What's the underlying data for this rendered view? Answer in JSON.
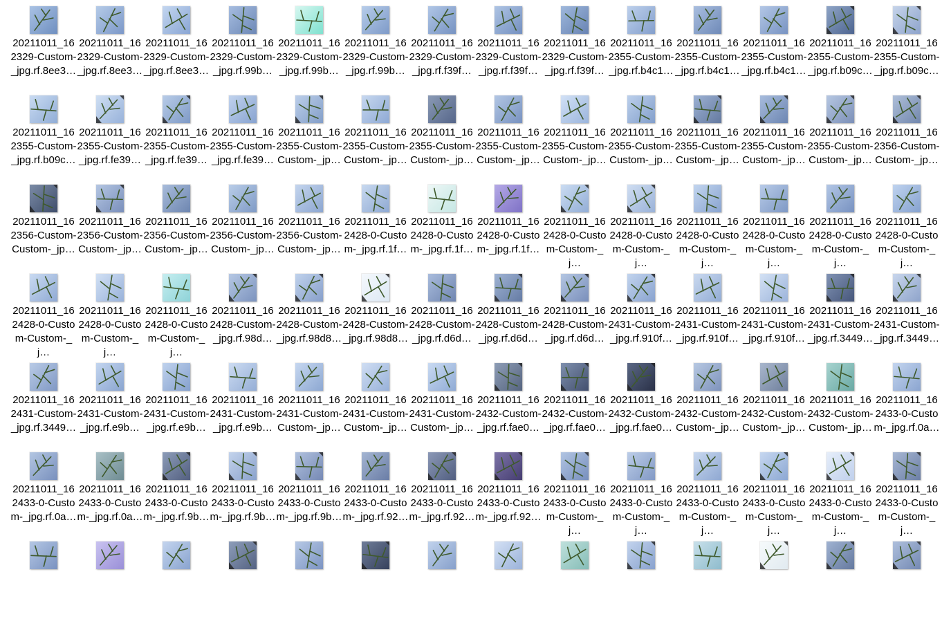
{
  "explorer": {
    "view": "large-icons",
    "files": [
      {
        "name": "20211011_162329-Custom-_jpg.rf.8ee3…",
        "bg": [
          "#a9c2e4",
          "#6f8fc0"
        ],
        "dark": false
      },
      {
        "name": "20211011_162329-Custom-_jpg.rf.8ee3…",
        "bg": [
          "#b5cbe8",
          "#7c98c8"
        ],
        "dark": false
      },
      {
        "name": "20211011_162329-Custom-_jpg.rf.8ee3…",
        "bg": [
          "#c3d6f0",
          "#8aa6d4"
        ],
        "dark": false
      },
      {
        "name": "20211011_162329-Custom-_jpg.rf.99b…",
        "bg": [
          "#a6bde0",
          "#6d88b6"
        ],
        "dark": false
      },
      {
        "name": "20211011_162329-Custom-_jpg.rf.99b…",
        "bg": [
          "#d6f7f0",
          "#7fe1cf"
        ],
        "dark": false
      },
      {
        "name": "20211011_162329-Custom-_jpg.rf.99b…",
        "bg": [
          "#b7cdea",
          "#7e9ac8"
        ],
        "dark": false
      },
      {
        "name": "20211011_162329-Custom-_jpg.rf.f39f…",
        "bg": [
          "#b0c6e6",
          "#7793c2"
        ],
        "dark": false
      },
      {
        "name": "20211011_162329-Custom-_jpg.rf.f39f…",
        "bg": [
          "#aec4e4",
          "#7490c0"
        ],
        "dark": false
      },
      {
        "name": "20211011_162329-Custom-_jpg.rf.f39f…",
        "bg": [
          "#9fb8dc",
          "#6883b3"
        ],
        "dark": false
      },
      {
        "name": "20211011_162355-Custom-_jpg.rf.b4c1…",
        "bg": [
          "#bdd0ec",
          "#849fcc"
        ],
        "dark": false
      },
      {
        "name": "20211011_162355-Custom-_jpg.rf.b4c1…",
        "bg": [
          "#a9bedf",
          "#6f8ab8"
        ],
        "dark": false
      },
      {
        "name": "20211011_162355-Custom-_jpg.rf.b4c1…",
        "bg": [
          "#b3c7e6",
          "#7893c2"
        ],
        "dark": false
      },
      {
        "name": "20211011_162355-Custom-_jpg.rf.b09c…",
        "bg": [
          "#8ea4c6",
          "#4e6590"
        ],
        "dark": true
      },
      {
        "name": "20211011_162355-Custom-_jpg.rf.b09c…",
        "bg": [
          "#c6d4ea",
          "#8ea4cc"
        ],
        "dark": true
      },
      {
        "name": "20211011_162355-Custom-_jpg.rf.b09c…",
        "bg": [
          "#c9dbf2",
          "#91add6"
        ],
        "dark": false
      },
      {
        "name": "20211011_162355-Custom-_jpg.rf.fe39…",
        "bg": [
          "#cfdff3",
          "#98b2da"
        ],
        "dark": true
      },
      {
        "name": "20211011_162355-Custom-_jpg.rf.fe39…",
        "bg": [
          "#b8cce8",
          "#7f9ac6"
        ],
        "dark": true
      },
      {
        "name": "20211011_162355-Custom-_jpg.rf.fe39…",
        "bg": [
          "#c1d3ee",
          "#88a3d0"
        ],
        "dark": false
      },
      {
        "name": "20211011_162355-Custom-Custom-_jp…",
        "bg": [
          "#bccfea",
          "#839ec8"
        ],
        "dark": true
      },
      {
        "name": "20211011_162355-Custom-Custom-_jp…",
        "bg": [
          "#c7d8f0",
          "#8ea9d4"
        ],
        "dark": false
      },
      {
        "name": "20211011_162355-Custom-Custom-_jp…",
        "bg": [
          "#8a9ab5",
          "#56668a"
        ],
        "dark": false
      },
      {
        "name": "20211011_162355-Custom-Custom-_jp…",
        "bg": [
          "#b2c6e4",
          "#7892c0"
        ],
        "dark": false
      },
      {
        "name": "20211011_162355-Custom-Custom-_jp…",
        "bg": [
          "#d2e1f6",
          "#9bb5dc"
        ],
        "dark": false
      },
      {
        "name": "20211011_162355-Custom-Custom-_jp…",
        "bg": [
          "#bcd0ec",
          "#839fcb"
        ],
        "dark": false
      },
      {
        "name": "20211011_162355-Custom-Custom-_jp…",
        "bg": [
          "#9db2d4",
          "#64799f"
        ],
        "dark": true
      },
      {
        "name": "20211011_162355-Custom-Custom-_jp…",
        "bg": [
          "#a7bcdd",
          "#6d86b2"
        ],
        "dark": true
      },
      {
        "name": "20211011_162355-Custom-Custom-_jp…",
        "bg": [
          "#b6c7e2",
          "#7c90b8"
        ],
        "dark": true
      },
      {
        "name": "20211011_162356-Custom-Custom-_jp…",
        "bg": [
          "#aebfd9",
          "#7287ad"
        ],
        "dark": true
      },
      {
        "name": "20211011_162356-Custom-Custom-_jp…",
        "bg": [
          "#7b8ba6",
          "#3f4e6b"
        ],
        "dark": true
      },
      {
        "name": "20211011_162356-Custom-Custom-_jp…",
        "bg": [
          "#b4c6e2",
          "#7a8fbb"
        ],
        "dark": true
      },
      {
        "name": "20211011_162356-Custom-Custom-_jp…",
        "bg": [
          "#a8bcdb",
          "#6e86b0"
        ],
        "dark": false
      },
      {
        "name": "20211011_162356-Custom-Custom-_jp…",
        "bg": [
          "#b9cde8",
          "#809bc6"
        ],
        "dark": false
      },
      {
        "name": "20211011_162356-Custom-Custom-_jp…",
        "bg": [
          "#c4d5ee",
          "#8ca6d0"
        ],
        "dark": false
      },
      {
        "name": "20211011_162428-0-Custom-_jpg.rf.1f…",
        "bg": [
          "#c8d9f0",
          "#8fa9d2"
        ],
        "dark": false
      },
      {
        "name": "20211011_162428-0-Custom-_jpg.rf.1f…",
        "bg": [
          "#edf7f6",
          "#c6e7e4"
        ],
        "dark": false
      },
      {
        "name": "20211011_162428-0-Custom-_jpg.rf.1f…",
        "bg": [
          "#b4a9e6",
          "#7f72c6"
        ],
        "dark": false
      },
      {
        "name": "20211011_162428-0-Custom-Custom-_j…",
        "bg": [
          "#cbdcf2",
          "#93aed6"
        ],
        "dark": true
      },
      {
        "name": "20211011_162428-0-Custom-Custom-_j…",
        "bg": [
          "#d0def2",
          "#9ab2d8"
        ],
        "dark": true
      },
      {
        "name": "20211011_162428-0-Custom-Custom-_j…",
        "bg": [
          "#c2d5ef",
          "#89a4d0"
        ],
        "dark": false
      },
      {
        "name": "20211011_162428-0-Custom-Custom-_j…",
        "bg": [
          "#b8cbe8",
          "#7f99c5"
        ],
        "dark": false
      },
      {
        "name": "20211011_162428-0-Custom-Custom-_j…",
        "bg": [
          "#b2c6e5",
          "#7892c1"
        ],
        "dark": false
      },
      {
        "name": "20211011_162428-0-Custom-Custom-_j…",
        "bg": [
          "#bfd3ef",
          "#86a2cf"
        ],
        "dark": false
      },
      {
        "name": "20211011_162428-0-Custom-Custom-_j…",
        "bg": [
          "#c9daf1",
          "#90aad4"
        ],
        "dark": false
      },
      {
        "name": "20211011_162428-0-Custom-Custom-_j…",
        "bg": [
          "#d1e0f4",
          "#99b2da"
        ],
        "dark": false
      },
      {
        "name": "20211011_162428-0-Custom-Custom-_j…",
        "bg": [
          "#c6eef0",
          "#8fd3d8"
        ],
        "dark": false
      },
      {
        "name": "20211011_162428-Custom-_jpg.rf.98d…",
        "bg": [
          "#b6c8e4",
          "#7c93be"
        ],
        "dark": true
      },
      {
        "name": "20211011_162428-Custom-_jpg.rf.98d8…",
        "bg": [
          "#c0d2ec",
          "#879fca"
        ],
        "dark": true
      },
      {
        "name": "20211011_162428-Custom-_jpg.rf.98d8…",
        "bg": [
          "#f4f8fc",
          "#dde8f4"
        ],
        "dark": true
      },
      {
        "name": "20211011_162428-Custom-_jpg.rf.d6d…",
        "bg": [
          "#a9bcdc",
          "#6f85b0"
        ],
        "dark": false
      },
      {
        "name": "20211011_162428-Custom-_jpg.rf.d6d…",
        "bg": [
          "#9fb3d3",
          "#657ba4"
        ],
        "dark": true
      },
      {
        "name": "20211011_162428-Custom-_jpg.rf.d6d…",
        "bg": [
          "#b4c6e2",
          "#7a8fbb"
        ],
        "dark": true
      },
      {
        "name": "20211011_162431-Custom-_jpg.rf.910f…",
        "bg": [
          "#c2d4ee",
          "#89a3cf"
        ],
        "dark": true
      },
      {
        "name": "20211011_162431-Custom-_jpg.rf.910f…",
        "bg": [
          "#cad9ef",
          "#92acd5"
        ],
        "dark": false
      },
      {
        "name": "20211011_162431-Custom-_jpg.rf.910f…",
        "bg": [
          "#d3e1f4",
          "#9cb4db"
        ],
        "dark": false
      },
      {
        "name": "20211011_162431-Custom-_jpg.rf.3449…",
        "bg": [
          "#8193b4",
          "#46567a"
        ],
        "dark": true
      },
      {
        "name": "20211011_162431-Custom-_jpg.rf.3449…",
        "bg": [
          "#c8d6ec",
          "#8fa4cb"
        ],
        "dark": true
      },
      {
        "name": "20211011_162431-Custom-_jpg.rf.3449…",
        "bg": [
          "#b9cbe6",
          "#8098c4"
        ],
        "dark": false
      },
      {
        "name": "20211011_162431-Custom-_jpg.rf.e9b…",
        "bg": [
          "#c3d5ef",
          "#8aa5d0"
        ],
        "dark": false
      },
      {
        "name": "20211011_162431-Custom-_jpg.rf.e9b…",
        "bg": [
          "#bfd2ed",
          "#86a1ce"
        ],
        "dark": false
      },
      {
        "name": "20211011_162431-Custom-_jpg.rf.e9b…",
        "bg": [
          "#cddcf2",
          "#95aed6"
        ],
        "dark": false
      },
      {
        "name": "20211011_162431-Custom-Custom-_jp…",
        "bg": [
          "#c6d7f0",
          "#8da8d2"
        ],
        "dark": false
      },
      {
        "name": "20211011_162431-Custom-Custom-_jp…",
        "bg": [
          "#d0def3",
          "#98b1d9"
        ],
        "dark": false
      },
      {
        "name": "20211011_162431-Custom-Custom-_jp…",
        "bg": [
          "#c9daf2",
          "#90abd5"
        ],
        "dark": false
      },
      {
        "name": "20211011_162432-Custom-_jpg.rf.fae0…",
        "bg": [
          "#8e9db6",
          "#55647f"
        ],
        "dark": true
      },
      {
        "name": "20211011_162432-Custom-_jpg.rf.fae0…",
        "bg": [
          "#7e8fad",
          "#434f6e"
        ],
        "dark": true
      },
      {
        "name": "20211011_162432-Custom-_jpg.rf.fae0…",
        "bg": [
          "#5a6784",
          "#2a3148"
        ],
        "dark": true
      },
      {
        "name": "20211011_162432-Custom-Custom-_jp…",
        "bg": [
          "#b7c8e2",
          "#7e93bc"
        ],
        "dark": false
      },
      {
        "name": "20211011_162432-Custom-Custom-_jp…",
        "bg": [
          "#a9b7cd",
          "#6f7f9c"
        ],
        "dark": false
      },
      {
        "name": "20211011_162432-Custom-Custom-_jp…",
        "bg": [
          "#a7d3cf",
          "#6aa9a4"
        ],
        "dark": false
      },
      {
        "name": "20211011_162433-0-Custom-_jpg.rf.0a…",
        "bg": [
          "#c4d5ef",
          "#8ba5d0"
        ],
        "dark": false
      },
      {
        "name": "20211011_162433-0-Custom-_jpg.rf.0a…",
        "bg": [
          "#b3c6e2",
          "#7990bd"
        ],
        "dark": false
      },
      {
        "name": "20211011_162433-0-Custom-_jpg.rf.0a…",
        "bg": [
          "#a9c0c6",
          "#6f8c93"
        ],
        "dark": false
      },
      {
        "name": "20211011_162433-0-Custom-_jpg.rf.9b…",
        "bg": [
          "#8c9cb8",
          "#535f80"
        ],
        "dark": true
      },
      {
        "name": "20211011_162433-0-Custom-_jpg.rf.9b…",
        "bg": [
          "#c3d3ec",
          "#8aa2cc"
        ],
        "dark": true
      },
      {
        "name": "20211011_162433-0-Custom-_jpg.rf.9b…",
        "bg": [
          "#b0c1de",
          "#7689b4"
        ],
        "dark": true
      },
      {
        "name": "20211011_162433-0-Custom-_jpg.rf.92…",
        "bg": [
          "#a4b5d2",
          "#6a7da6"
        ],
        "dark": false
      },
      {
        "name": "20211011_162433-0-Custom-_jpg.rf.92…",
        "bg": [
          "#8b98b6",
          "#515e80"
        ],
        "dark": true
      },
      {
        "name": "20211011_162433-0-Custom-_jpg.rf.92…",
        "bg": [
          "#7d74a8",
          "#453d70"
        ],
        "dark": true
      },
      {
        "name": "20211011_162433-0-Custom-Custom-_j…",
        "bg": [
          "#b1c4e2",
          "#778fbd"
        ],
        "dark": true
      },
      {
        "name": "20211011_162433-0-Custom-Custom-_j…",
        "bg": [
          "#bccde8",
          "#8299c5"
        ],
        "dark": false
      },
      {
        "name": "20211011_162433-0-Custom-Custom-_j…",
        "bg": [
          "#c8d8ef",
          "#8fa8d2"
        ],
        "dark": false
      },
      {
        "name": "20211011_162433-0-Custom-Custom-_j…",
        "bg": [
          "#c6d7f0",
          "#8da8d3"
        ],
        "dark": true
      },
      {
        "name": "20211011_162433-0-Custom-Custom-_j…",
        "bg": [
          "#e6eefa",
          "#c0d0ec"
        ],
        "dark": true
      },
      {
        "name": "20211011_162433-0-Custom-Custom-_j…",
        "bg": [
          "#a7b7d3",
          "#6c7fa6"
        ],
        "dark": true
      },
      {
        "name": "",
        "bg": [
          "#b4c7e4",
          "#7a92c0"
        ],
        "dark": false
      },
      {
        "name": "",
        "bg": [
          "#c9c3f0",
          "#9a8fd8"
        ],
        "dark": false
      },
      {
        "name": "",
        "bg": [
          "#c3d4ee",
          "#8aa4cf"
        ],
        "dark": false
      },
      {
        "name": "",
        "bg": [
          "#8d9db9",
          "#546282"
        ],
        "dark": true
      },
      {
        "name": "",
        "bg": [
          "#b6c8e5",
          "#7c94c2"
        ],
        "dark": false
      },
      {
        "name": "",
        "bg": [
          "#6f7d99",
          "#36415c"
        ],
        "dark": true
      },
      {
        "name": "",
        "bg": [
          "#c0d2ec",
          "#87a0cb"
        ],
        "dark": false
      },
      {
        "name": "",
        "bg": [
          "#d3e0f4",
          "#9cb3da"
        ],
        "dark": false
      },
      {
        "name": "",
        "bg": [
          "#bfe0dc",
          "#86bdb7"
        ],
        "dark": false
      },
      {
        "name": "",
        "bg": [
          "#c2d3ed",
          "#89a2ce"
        ],
        "dark": true
      },
      {
        "name": "",
        "bg": [
          "#c8e0ea",
          "#8fbccd"
        ],
        "dark": false
      },
      {
        "name": "",
        "bg": [
          "#f6fafb",
          "#e1eaf0"
        ],
        "dark": true
      },
      {
        "name": "",
        "bg": [
          "#9fb2d1",
          "#65799f"
        ],
        "dark": true
      },
      {
        "name": "",
        "bg": [
          "#aebfdc",
          "#7489b3"
        ],
        "dark": true
      }
    ]
  }
}
